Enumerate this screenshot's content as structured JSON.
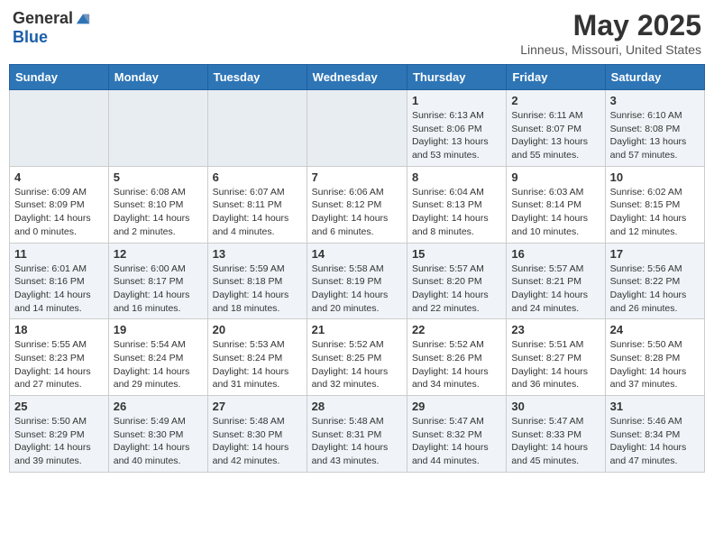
{
  "header": {
    "logo_general": "General",
    "logo_blue": "Blue",
    "month_title": "May 2025",
    "location": "Linneus, Missouri, United States"
  },
  "days_of_week": [
    "Sunday",
    "Monday",
    "Tuesday",
    "Wednesday",
    "Thursday",
    "Friday",
    "Saturday"
  ],
  "weeks": [
    [
      {
        "day": "",
        "sunrise": "",
        "sunset": "",
        "daylight": "",
        "empty": true
      },
      {
        "day": "",
        "sunrise": "",
        "sunset": "",
        "daylight": "",
        "empty": true
      },
      {
        "day": "",
        "sunrise": "",
        "sunset": "",
        "daylight": "",
        "empty": true
      },
      {
        "day": "",
        "sunrise": "",
        "sunset": "",
        "daylight": "",
        "empty": true
      },
      {
        "day": "1",
        "sunrise": "Sunrise: 6:13 AM",
        "sunset": "Sunset: 8:06 PM",
        "daylight": "Daylight: 13 hours and 53 minutes."
      },
      {
        "day": "2",
        "sunrise": "Sunrise: 6:11 AM",
        "sunset": "Sunset: 8:07 PM",
        "daylight": "Daylight: 13 hours and 55 minutes."
      },
      {
        "day": "3",
        "sunrise": "Sunrise: 6:10 AM",
        "sunset": "Sunset: 8:08 PM",
        "daylight": "Daylight: 13 hours and 57 minutes."
      }
    ],
    [
      {
        "day": "4",
        "sunrise": "Sunrise: 6:09 AM",
        "sunset": "Sunset: 8:09 PM",
        "daylight": "Daylight: 14 hours and 0 minutes."
      },
      {
        "day": "5",
        "sunrise": "Sunrise: 6:08 AM",
        "sunset": "Sunset: 8:10 PM",
        "daylight": "Daylight: 14 hours and 2 minutes."
      },
      {
        "day": "6",
        "sunrise": "Sunrise: 6:07 AM",
        "sunset": "Sunset: 8:11 PM",
        "daylight": "Daylight: 14 hours and 4 minutes."
      },
      {
        "day": "7",
        "sunrise": "Sunrise: 6:06 AM",
        "sunset": "Sunset: 8:12 PM",
        "daylight": "Daylight: 14 hours and 6 minutes."
      },
      {
        "day": "8",
        "sunrise": "Sunrise: 6:04 AM",
        "sunset": "Sunset: 8:13 PM",
        "daylight": "Daylight: 14 hours and 8 minutes."
      },
      {
        "day": "9",
        "sunrise": "Sunrise: 6:03 AM",
        "sunset": "Sunset: 8:14 PM",
        "daylight": "Daylight: 14 hours and 10 minutes."
      },
      {
        "day": "10",
        "sunrise": "Sunrise: 6:02 AM",
        "sunset": "Sunset: 8:15 PM",
        "daylight": "Daylight: 14 hours and 12 minutes."
      }
    ],
    [
      {
        "day": "11",
        "sunrise": "Sunrise: 6:01 AM",
        "sunset": "Sunset: 8:16 PM",
        "daylight": "Daylight: 14 hours and 14 minutes."
      },
      {
        "day": "12",
        "sunrise": "Sunrise: 6:00 AM",
        "sunset": "Sunset: 8:17 PM",
        "daylight": "Daylight: 14 hours and 16 minutes."
      },
      {
        "day": "13",
        "sunrise": "Sunrise: 5:59 AM",
        "sunset": "Sunset: 8:18 PM",
        "daylight": "Daylight: 14 hours and 18 minutes."
      },
      {
        "day": "14",
        "sunrise": "Sunrise: 5:58 AM",
        "sunset": "Sunset: 8:19 PM",
        "daylight": "Daylight: 14 hours and 20 minutes."
      },
      {
        "day": "15",
        "sunrise": "Sunrise: 5:57 AM",
        "sunset": "Sunset: 8:20 PM",
        "daylight": "Daylight: 14 hours and 22 minutes."
      },
      {
        "day": "16",
        "sunrise": "Sunrise: 5:57 AM",
        "sunset": "Sunset: 8:21 PM",
        "daylight": "Daylight: 14 hours and 24 minutes."
      },
      {
        "day": "17",
        "sunrise": "Sunrise: 5:56 AM",
        "sunset": "Sunset: 8:22 PM",
        "daylight": "Daylight: 14 hours and 26 minutes."
      }
    ],
    [
      {
        "day": "18",
        "sunrise": "Sunrise: 5:55 AM",
        "sunset": "Sunset: 8:23 PM",
        "daylight": "Daylight: 14 hours and 27 minutes."
      },
      {
        "day": "19",
        "sunrise": "Sunrise: 5:54 AM",
        "sunset": "Sunset: 8:24 PM",
        "daylight": "Daylight: 14 hours and 29 minutes."
      },
      {
        "day": "20",
        "sunrise": "Sunrise: 5:53 AM",
        "sunset": "Sunset: 8:24 PM",
        "daylight": "Daylight: 14 hours and 31 minutes."
      },
      {
        "day": "21",
        "sunrise": "Sunrise: 5:52 AM",
        "sunset": "Sunset: 8:25 PM",
        "daylight": "Daylight: 14 hours and 32 minutes."
      },
      {
        "day": "22",
        "sunrise": "Sunrise: 5:52 AM",
        "sunset": "Sunset: 8:26 PM",
        "daylight": "Daylight: 14 hours and 34 minutes."
      },
      {
        "day": "23",
        "sunrise": "Sunrise: 5:51 AM",
        "sunset": "Sunset: 8:27 PM",
        "daylight": "Daylight: 14 hours and 36 minutes."
      },
      {
        "day": "24",
        "sunrise": "Sunrise: 5:50 AM",
        "sunset": "Sunset: 8:28 PM",
        "daylight": "Daylight: 14 hours and 37 minutes."
      }
    ],
    [
      {
        "day": "25",
        "sunrise": "Sunrise: 5:50 AM",
        "sunset": "Sunset: 8:29 PM",
        "daylight": "Daylight: 14 hours and 39 minutes."
      },
      {
        "day": "26",
        "sunrise": "Sunrise: 5:49 AM",
        "sunset": "Sunset: 8:30 PM",
        "daylight": "Daylight: 14 hours and 40 minutes."
      },
      {
        "day": "27",
        "sunrise": "Sunrise: 5:48 AM",
        "sunset": "Sunset: 8:30 PM",
        "daylight": "Daylight: 14 hours and 42 minutes."
      },
      {
        "day": "28",
        "sunrise": "Sunrise: 5:48 AM",
        "sunset": "Sunset: 8:31 PM",
        "daylight": "Daylight: 14 hours and 43 minutes."
      },
      {
        "day": "29",
        "sunrise": "Sunrise: 5:47 AM",
        "sunset": "Sunset: 8:32 PM",
        "daylight": "Daylight: 14 hours and 44 minutes."
      },
      {
        "day": "30",
        "sunrise": "Sunrise: 5:47 AM",
        "sunset": "Sunset: 8:33 PM",
        "daylight": "Daylight: 14 hours and 45 minutes."
      },
      {
        "day": "31",
        "sunrise": "Sunrise: 5:46 AM",
        "sunset": "Sunset: 8:34 PM",
        "daylight": "Daylight: 14 hours and 47 minutes."
      }
    ]
  ]
}
